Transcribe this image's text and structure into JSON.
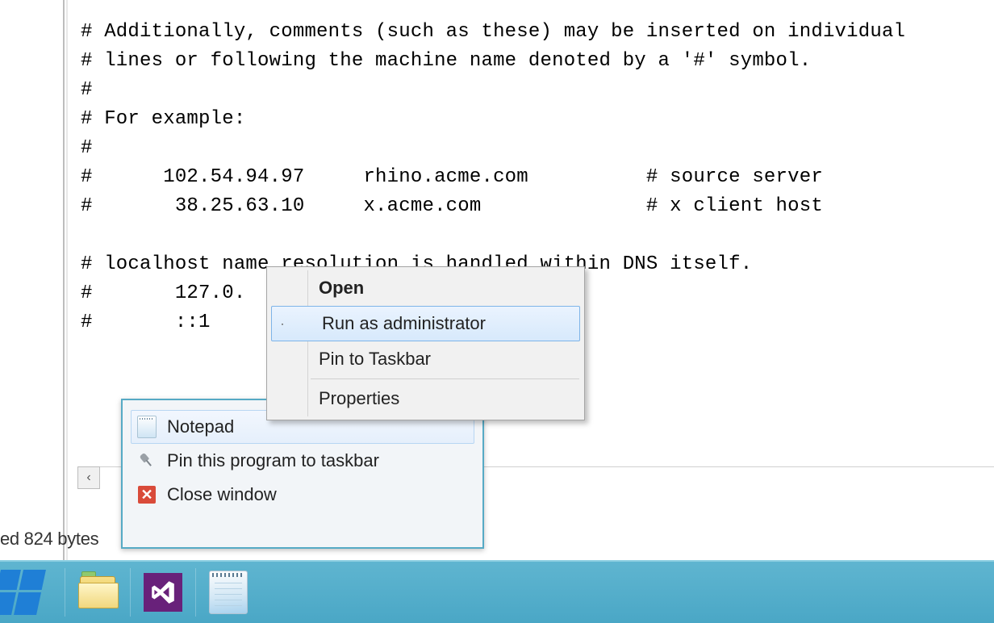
{
  "editor": {
    "content": "# Additionally, comments (such as these) may be inserted on individual\n# lines or following the machine name denoted by a '#' symbol.\n#\n# For example:\n#\n#      102.54.94.97     rhino.acme.com          # source server\n#       38.25.63.10     x.acme.com              # x client host\n\n# localhost name resolution is handled within DNS itself.\n#       127.0.\n#       ::1"
  },
  "status": {
    "text": "ed  824 bytes"
  },
  "jumplist": {
    "app_label": "Notepad",
    "pin_label": "Pin this program to taskbar",
    "close_label": "Close window"
  },
  "context_menu": {
    "open_label": "Open",
    "run_admin_label": "Run as administrator",
    "pin_taskbar_label": "Pin to Taskbar",
    "properties_label": "Properties"
  },
  "icons": {
    "shield": "shield-icon",
    "pin": "pin-icon",
    "close": "close-icon",
    "notepad": "notepad-icon"
  }
}
